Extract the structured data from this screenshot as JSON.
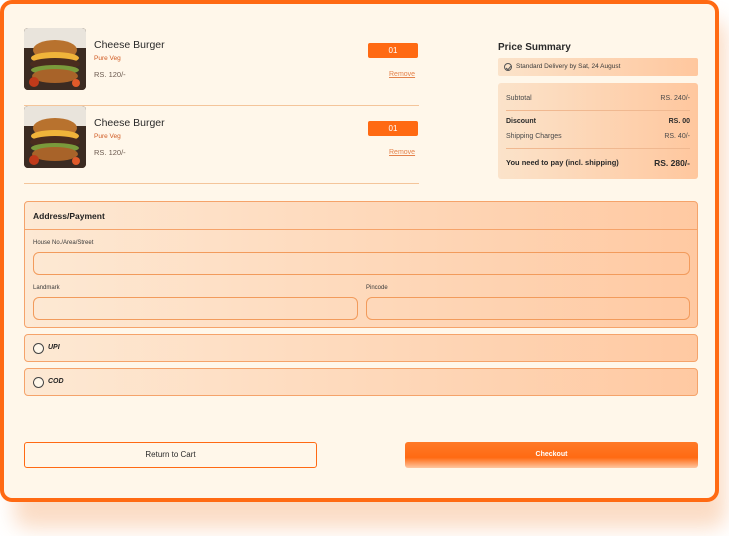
{
  "cart": {
    "items": [
      {
        "name": "Cheese Burger",
        "tag": "Pure Veg",
        "price": "RS. 120/-",
        "qty": "01",
        "remove": "Remove"
      },
      {
        "name": "Cheese Burger",
        "tag": "Pure Veg",
        "price": "RS. 120/-",
        "qty": "01",
        "remove": "Remove"
      }
    ]
  },
  "summary": {
    "title": "Price Summary",
    "delivery": "Standard Delivery by Sat, 24 August",
    "subtotal_label": "Subtotal",
    "subtotal_value": "RS. 240/-",
    "discount_label": "Discount",
    "discount_value": "RS. 00",
    "shipping_label": "Shipping Charges",
    "shipping_value": "RS. 40/-",
    "total_label": "You need to pay (incl. shipping)",
    "total_value": "RS. 280/-"
  },
  "address": {
    "title": "Address/Payment",
    "house_label": "House No./Area/Street",
    "landmark_label": "Landmark",
    "pincode_label": "Pincode"
  },
  "payment": {
    "upi": "UPI",
    "cod": "COD"
  },
  "actions": {
    "return": "Return to Cart",
    "checkout": "Checkout"
  },
  "colors": {
    "accent": "#ff6a13",
    "background": "#fff7ea"
  }
}
